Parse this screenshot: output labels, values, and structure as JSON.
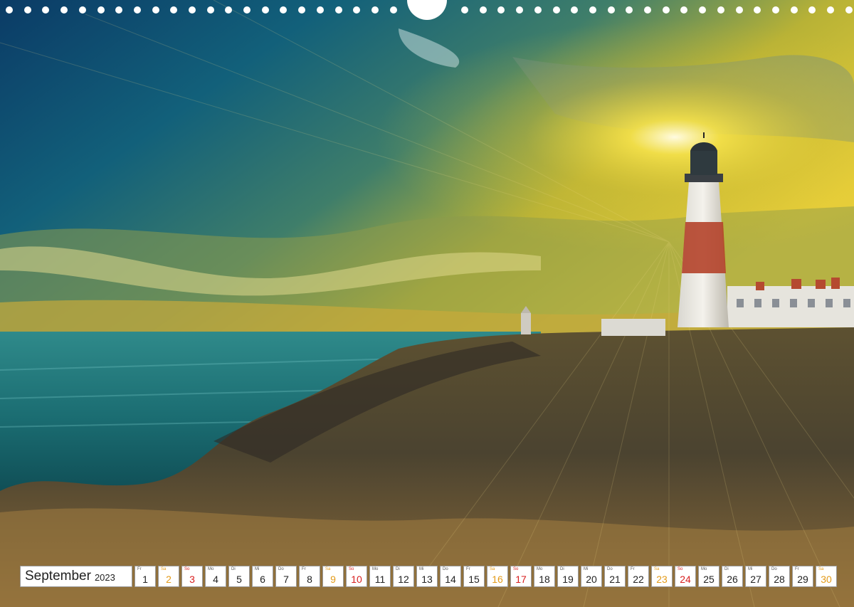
{
  "calendar": {
    "month": "September",
    "year": "2023",
    "days": [
      {
        "wd": "Fr",
        "n": "1",
        "type": "weekday"
      },
      {
        "wd": "Sa",
        "n": "2",
        "type": "sat"
      },
      {
        "wd": "So",
        "n": "3",
        "type": "sun"
      },
      {
        "wd": "Mo",
        "n": "4",
        "type": "weekday"
      },
      {
        "wd": "Di",
        "n": "5",
        "type": "weekday"
      },
      {
        "wd": "Mi",
        "n": "6",
        "type": "weekday"
      },
      {
        "wd": "Do",
        "n": "7",
        "type": "weekday"
      },
      {
        "wd": "Fr",
        "n": "8",
        "type": "weekday"
      },
      {
        "wd": "Sa",
        "n": "9",
        "type": "sat"
      },
      {
        "wd": "So",
        "n": "10",
        "type": "sun"
      },
      {
        "wd": "Mo",
        "n": "11",
        "type": "weekday"
      },
      {
        "wd": "Di",
        "n": "12",
        "type": "weekday"
      },
      {
        "wd": "Mi",
        "n": "13",
        "type": "weekday"
      },
      {
        "wd": "Do",
        "n": "14",
        "type": "weekday"
      },
      {
        "wd": "Fr",
        "n": "15",
        "type": "weekday"
      },
      {
        "wd": "Sa",
        "n": "16",
        "type": "sat"
      },
      {
        "wd": "So",
        "n": "17",
        "type": "sun"
      },
      {
        "wd": "Mo",
        "n": "18",
        "type": "weekday"
      },
      {
        "wd": "Di",
        "n": "19",
        "type": "weekday"
      },
      {
        "wd": "Mi",
        "n": "20",
        "type": "weekday"
      },
      {
        "wd": "Do",
        "n": "21",
        "type": "weekday"
      },
      {
        "wd": "Fr",
        "n": "22",
        "type": "weekday"
      },
      {
        "wd": "Sa",
        "n": "23",
        "type": "sat"
      },
      {
        "wd": "So",
        "n": "24",
        "type": "sun"
      },
      {
        "wd": "Mo",
        "n": "25",
        "type": "weekday"
      },
      {
        "wd": "Di",
        "n": "26",
        "type": "weekday"
      },
      {
        "wd": "Mi",
        "n": "27",
        "type": "weekday"
      },
      {
        "wd": "Do",
        "n": "28",
        "type": "weekday"
      },
      {
        "wd": "Fr",
        "n": "29",
        "type": "weekday"
      },
      {
        "wd": "Sa",
        "n": "30",
        "type": "sat"
      }
    ]
  },
  "colors": {
    "saturday": "#e39a18",
    "sunday": "#d81e1e",
    "box_border": "#9a9a9a"
  },
  "icons": {
    "binding_hole": "binding-hole-icon",
    "hanger_hole": "hanger-hole-icon"
  }
}
